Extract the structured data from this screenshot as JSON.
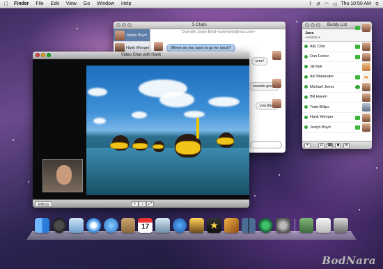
{
  "menubar": {
    "apple": "",
    "app_name": "Finder",
    "menus": [
      "File",
      "Edit",
      "View",
      "Go",
      "Window",
      "Help"
    ],
    "clock": "Thu 10:50 AM"
  },
  "chats_window": {
    "title": "5 Chats",
    "header": "Chat with Joslyn Boyd <joslynboyd@mac.com>",
    "tabs": [
      {
        "name": "Joslyn Boyd"
      },
      {
        "name": "Hank Wenger"
      }
    ],
    "messages": [
      {
        "text": "Where do you want to go for lunch?"
      },
      {
        "text": "vrnc!"
      },
      {
        "text": "sounds great!"
      },
      {
        "text": "you then"
      }
    ]
  },
  "video_window": {
    "title": "Video Chat with Hank",
    "effects_label": "Effects",
    "controls": [
      "+",
      "↓",
      "⤢"
    ]
  },
  "buddy_list": {
    "title": "Buddy List",
    "me": {
      "name": "Jane",
      "status": "Available ▾"
    },
    "buddies": [
      {
        "name": "Ally Chin"
      },
      {
        "name": "Dan Foster"
      },
      {
        "name": "Jill Bell"
      },
      {
        "name": "Aki Watanabe"
      },
      {
        "name": "Michael Jones"
      },
      {
        "name": "Bill Haven"
      },
      {
        "name": "Todd Billips"
      },
      {
        "name": "Hank Wenger"
      },
      {
        "name": "Joslyn Boyd"
      }
    ],
    "toolbar": [
      "+",
      "A",
      "☎",
      "■",
      "✉"
    ]
  },
  "dock": {
    "icons": [
      "finder-icon",
      "dashboard-icon",
      "mail-icon",
      "safari-icon",
      "ichat-icon",
      "address-book-icon",
      "ical-icon",
      "iphoto-icon",
      "itunes-icon",
      "imovie-icon",
      "photo-booth-icon",
      "garageband-icon",
      "spaces-icon",
      "time-machine-icon",
      "system-preferences-icon",
      "downloads-stack-icon",
      "documents-stack-icon",
      "trash-icon"
    ],
    "ical_day": "17"
  },
  "watermark": "BodNara"
}
